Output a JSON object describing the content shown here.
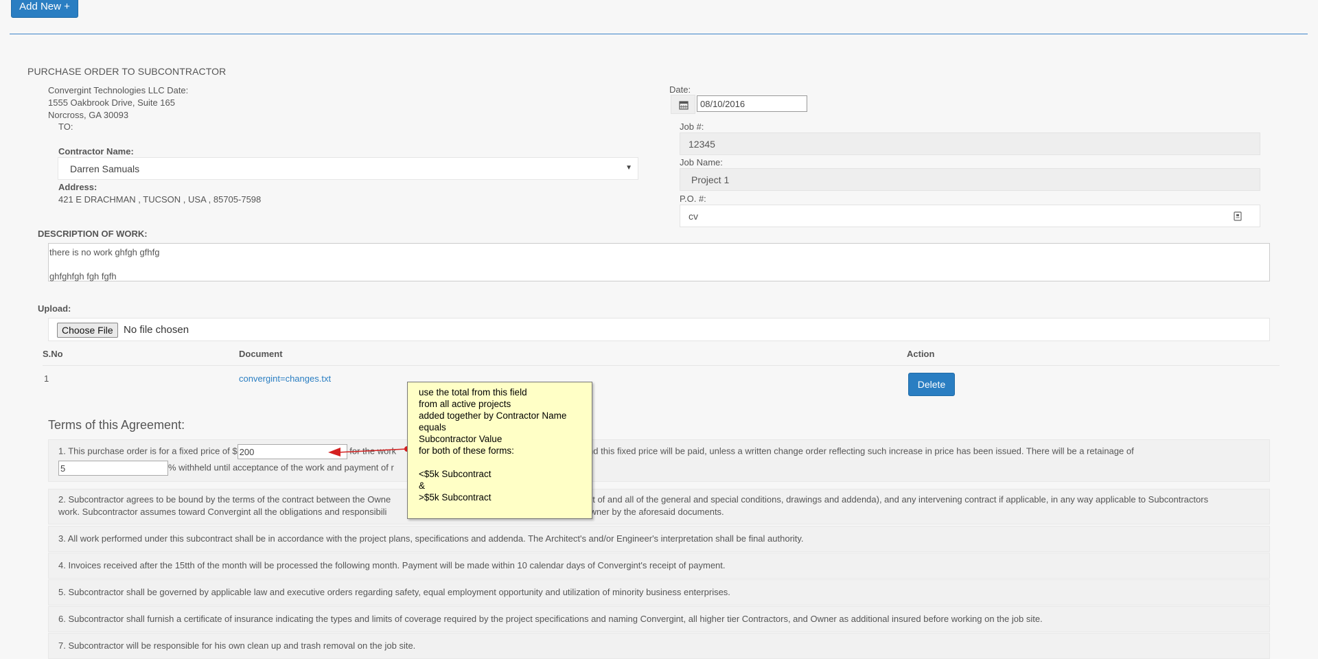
{
  "toolbar": {
    "add_new_label": "Add New +"
  },
  "po": {
    "title": "PURCHASE ORDER TO SUBCONTRACTOR",
    "company_line": "Convergint Technologies LLC Date:",
    "street": "1555 Oakbrook Drive, Suite 165",
    "city": "Norcross, GA 30093",
    "to_label": "TO:"
  },
  "contractor": {
    "label": "Contractor Name:",
    "value": "Darren Samuals",
    "address_label": "Address:",
    "address_value": "421 E DRACHMAN , TUCSON , USA , 85705-7598"
  },
  "right": {
    "date_label": "Date:",
    "date_value": "08/10/2016",
    "job_no_label": "Job #:",
    "job_no_value": "12345",
    "job_name_label": "Job Name:",
    "job_name_value": "Project 1",
    "po_no_label": "P.O. #:",
    "po_no_value": "cv"
  },
  "description": {
    "label": "DESCRIPTION OF WORK:",
    "line1": "there is no work ghfgh gfhfg",
    "line2": "ghfghfgh fgh fgfh"
  },
  "upload": {
    "label": "Upload:",
    "choose_label": "Choose File",
    "no_file_text": "No file chosen"
  },
  "documents": {
    "headers": {
      "sno": "S.No",
      "document": "Document",
      "action": "Action"
    },
    "rows": [
      {
        "sno": "1",
        "document": "convergint=changes.txt",
        "action": "Delete"
      }
    ]
  },
  "terms": {
    "title": "Terms of this Agreement:",
    "t1_a": "1. This purchase order is for a fixed price of $",
    "t1_price": "200",
    "t1_b": "for the work",
    "t1_c": "nt beyond this fixed price will be paid, unless a written change order reflecting such increase in price has been issued. There will be a retainage of",
    "t1_retainage": "5",
    "t1_d": "% withheld until acceptance of the work and payment of r",
    "t2_a": "2. Subcontractor agrees to be bound by the terms of the contract between the Owne",
    "t2_b": "part of and all of the general and special conditions, drawings and addenda), and any intervening contract if applicable, in any way applicable to Subcontractors",
    "t2_c": "work. Subcontractor assumes toward Convergint all the obligations and responsibili",
    "t2_d": "e Owner by the aforesaid documents.",
    "t3": "3. All work performed under this subcontract shall be in accordance with the project plans, specifications and addenda. The Architect's and/or Engineer's interpretation shall be final authority.",
    "t4": "4. Invoices received after the 15tth of the month will be processed the following month. Payment will be made within 10 calendar days of Convergint's receipt of payment.",
    "t5": "5. Subcontractor shall be governed by applicable law and executive orders regarding safety, equal employment opportunity and utilization of minority business enterprises.",
    "t6": "6. Subcontractor shall furnish a certificate of insurance indicating the types and limits of coverage required by the project specifications and naming Convergint, all higher tier Contractors, and Owner as additional insured before working on the job site.",
    "t7": "7. Subcontractor will be responsible for his own clean up and trash removal on the job site."
  },
  "annotation": {
    "text": "use the total from this field\nfrom all active projects\nadded together by Contractor Name\nequals\nSubcontractor Value\nfor both of these forms:\n\n<$5k Subcontract\n&\n>$5k Subcontract",
    "arrow_color": "#d42020"
  },
  "colors": {
    "accent": "#2a7ec2",
    "note_bg": "#ffffc6"
  }
}
